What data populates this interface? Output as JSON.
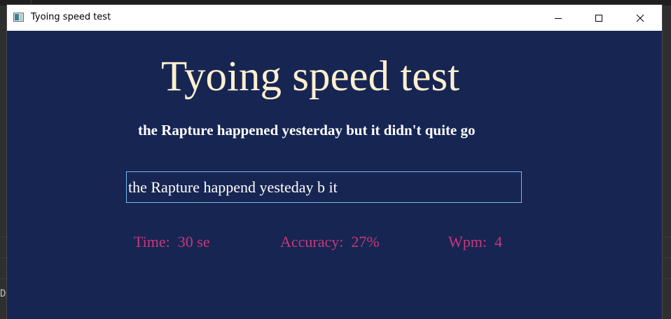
{
  "window": {
    "title": "Tyoing speed test",
    "controls": {
      "minimize_icon": "minimize-icon",
      "maximize_icon": "maximize-icon",
      "close_icon": "close-icon"
    }
  },
  "app": {
    "heading": "Tyoing speed test",
    "sentence": "the Rapture happened yesterday but it didn't quite go",
    "entry_value": "the Rapture happend yesteday b it",
    "stats": {
      "time_label": "Time:  ",
      "time_value": "30 se",
      "accuracy_label": "Accuracy:  ",
      "accuracy_value": "27%",
      "wpm_label": "Wpm:  ",
      "wpm_value": "4"
    }
  },
  "background": {
    "partial_text": "De"
  },
  "colors": {
    "window_bg": "#172553",
    "heading": "#fcf0cf",
    "stats": "#c9377a",
    "entry_border": "#77b9ef"
  }
}
